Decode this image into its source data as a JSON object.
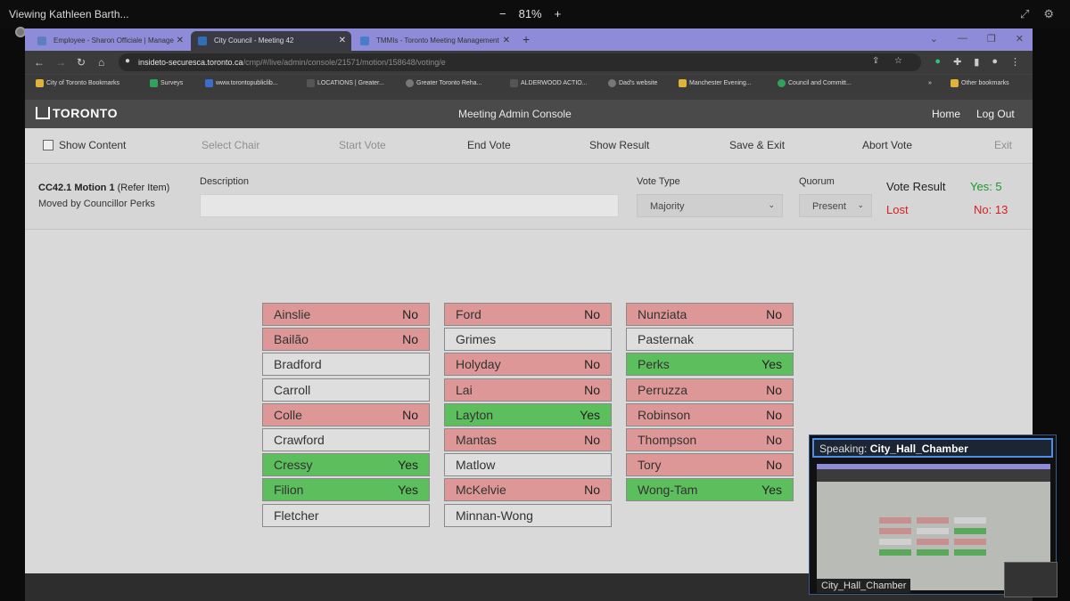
{
  "viewer": {
    "title": "Viewing Kathleen Barth...",
    "zoom_minus": "−",
    "zoom_level": "81%",
    "zoom_plus": "+"
  },
  "browser": {
    "tabs": [
      {
        "label": "Employee - Sharon Officiale | Manage",
        "active": false
      },
      {
        "label": "City Council - Meeting 42",
        "active": true
      },
      {
        "label": "TMMIs - Toronto Meeting Management",
        "active": false
      }
    ],
    "url_host": "insideto-securesca.toronto.ca",
    "url_path": "/cmp/#/live/admin/console/21571/motion/158648/voting/e",
    "bookmarks": [
      "City of Toronto Bookmarks",
      "Surveys",
      "www.torontopubliclib...",
      "LOCATIONS | Greater...",
      "Greater Toronto Reha...",
      "ALDERWOOD ACTIO...",
      "Dad's website",
      "Manchester Evening...",
      "Council and Committ...",
      "Other bookmarks"
    ]
  },
  "app": {
    "logo": "TORONTO",
    "title": "Meeting Admin Console",
    "home": "Home",
    "logout": "Log Out"
  },
  "toolbar": {
    "show_content": "Show Content",
    "select_chair": "Select Chair",
    "start_vote": "Start Vote",
    "end_vote": "End Vote",
    "show_result": "Show Result",
    "save_exit": "Save & Exit",
    "abort_vote": "Abort Vote",
    "exit": "Exit"
  },
  "motion": {
    "id": "CC42.1 Motion 1",
    "type": "(Refer Item)",
    "moved_by": "Moved by Councillor Perks",
    "description_label": "Description",
    "description_value": "",
    "vote_type_label": "Vote Type",
    "vote_type_value": "Majority",
    "quorum_label": "Quorum",
    "quorum_value": "Present",
    "result_label": "Vote Result",
    "result_status": "Lost",
    "yes_count": "Yes: 5",
    "no_count": "No: 13"
  },
  "votes": [
    [
      {
        "name": "Ainslie",
        "vote": "No"
      },
      {
        "name": "Bailão",
        "vote": "No"
      },
      {
        "name": "Bradford",
        "vote": ""
      },
      {
        "name": "Carroll",
        "vote": ""
      },
      {
        "name": "Colle",
        "vote": "No"
      },
      {
        "name": "Crawford",
        "vote": ""
      },
      {
        "name": "Cressy",
        "vote": "Yes"
      },
      {
        "name": "Filion",
        "vote": "Yes"
      },
      {
        "name": "Fletcher",
        "vote": ""
      }
    ],
    [
      {
        "name": "Ford",
        "vote": "No"
      },
      {
        "name": "Grimes",
        "vote": ""
      },
      {
        "name": "Holyday",
        "vote": "No"
      },
      {
        "name": "Lai",
        "vote": "No"
      },
      {
        "name": "Layton",
        "vote": "Yes"
      },
      {
        "name": "Mantas",
        "vote": "No"
      },
      {
        "name": "Matlow",
        "vote": ""
      },
      {
        "name": "McKelvie",
        "vote": "No"
      },
      {
        "name": "Minnan-Wong",
        "vote": ""
      }
    ],
    [
      {
        "name": "Nunziata",
        "vote": "No"
      },
      {
        "name": "Pasternak",
        "vote": ""
      },
      {
        "name": "Perks",
        "vote": "Yes"
      },
      {
        "name": "Perruzza",
        "vote": "No"
      },
      {
        "name": "Robinson",
        "vote": "No"
      },
      {
        "name": "Thompson",
        "vote": "No"
      },
      {
        "name": "Tory",
        "vote": "No"
      },
      {
        "name": "Wong-Tam",
        "vote": "Yes"
      }
    ]
  ],
  "speaker": {
    "prefix": "Speaking:",
    "name": "City_Hall_Chamber",
    "tile_label": "City_Hall_Chamber"
  },
  "colors": {
    "no": "#de9797",
    "yes": "#5cbe5c",
    "none": "#dedede",
    "lost": "#d91e1e",
    "yes_text": "#1a9a2a"
  }
}
